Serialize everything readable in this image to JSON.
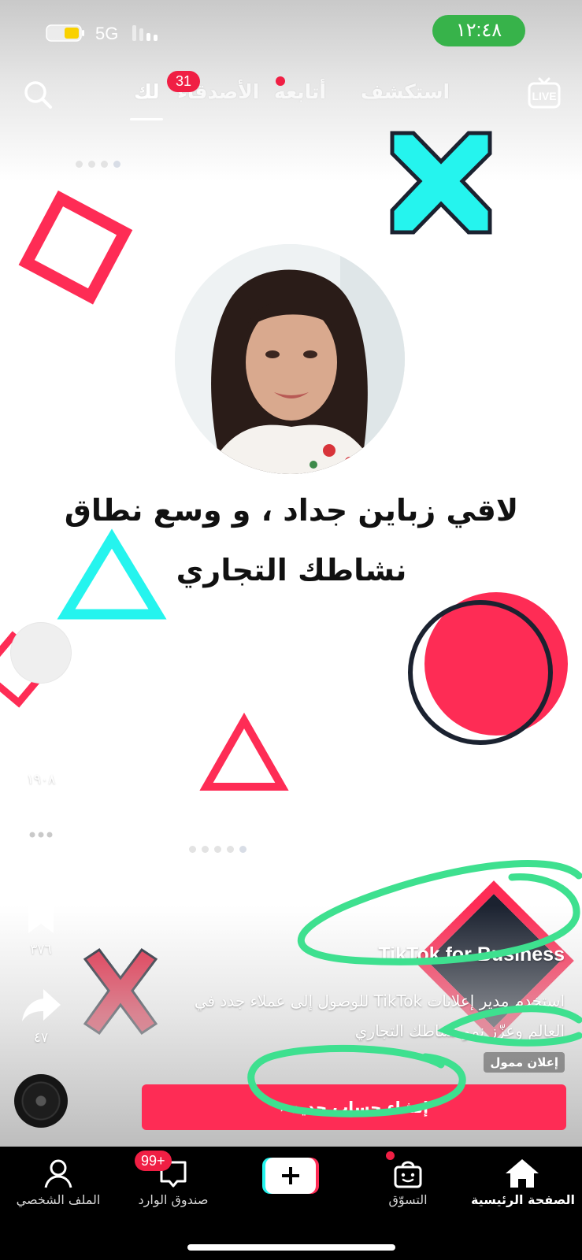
{
  "status_bar": {
    "network": "5G",
    "time": "١٢:٤٨",
    "battery_level": 0.4,
    "colors": {
      "time_pill": "#37b34a",
      "battery": "#f9d100"
    }
  },
  "top_nav": {
    "tabs": [
      {
        "label": "استكشف",
        "active": false
      },
      {
        "label": "أتابعه",
        "active": false
      },
      {
        "label": "الأصدقاء",
        "active": false
      },
      {
        "label": "لك",
        "active": true
      }
    ],
    "friends_badge": "31",
    "live_label": "LIVE",
    "icons": {
      "search": "search-icon",
      "live": "live-icon"
    }
  },
  "video": {
    "headline_line1": "لاقي زباين جداد ، و وسع نطاق",
    "headline_line2": "نشاطك التجاري",
    "accent_colors": {
      "red": "#fe2c55",
      "cyan": "#25f4ee",
      "dark": "#1b2230"
    }
  },
  "side_actions": {
    "likes": "١٩٠٨",
    "saves": "٣٧٦",
    "shares": "٤٧",
    "icons": [
      "heart-icon",
      "comment-icon",
      "bookmark-icon",
      "share-icon",
      "music-disc-icon"
    ]
  },
  "ad": {
    "brand": "TikTok for Business",
    "description": "استخدم مدير إعلانات TikTok للوصول إلى عملاء جدد في العالم وعزّز نمو نشاطك التجاري",
    "sponsored_label": "إعلان ممول",
    "cta_label": "إنشاء حساب جديد",
    "cta_color": "#fe2c55",
    "annotation_color": "#3ee08f"
  },
  "bottom_nav": {
    "items": [
      {
        "label": "الملف الشخصي",
        "icon": "profile-icon"
      },
      {
        "label": "صندوق الوارد",
        "icon": "inbox-icon",
        "badge": "99+"
      },
      {
        "label": "",
        "icon": "plus-icon"
      },
      {
        "label": "التسوّق",
        "icon": "shop-icon"
      },
      {
        "label": "الصفحة الرئيسية",
        "icon": "home-icon"
      }
    ]
  }
}
